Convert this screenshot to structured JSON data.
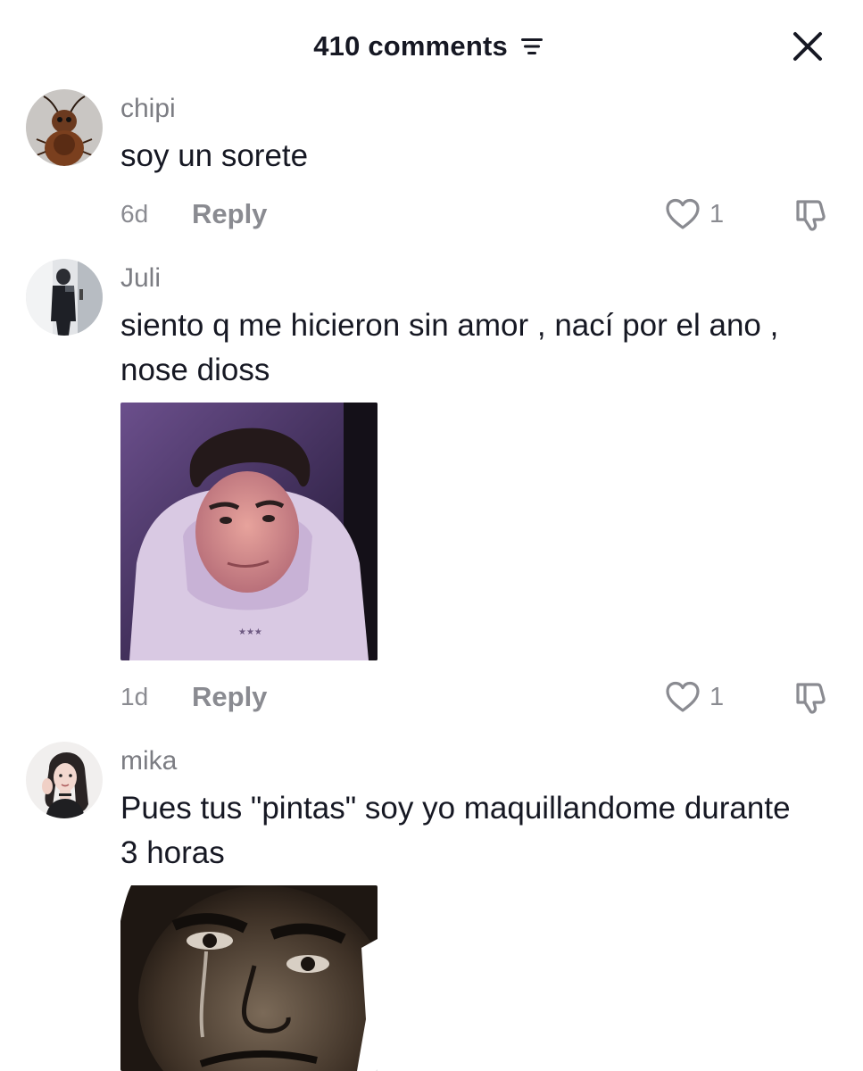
{
  "header": {
    "comment_count_label": "410 comments",
    "sort_icon": "sort-lines-icon",
    "close_icon": "close-x-icon"
  },
  "comments": [
    {
      "username": "chipi",
      "text": "soy un sorete",
      "time": "6d",
      "reply_label": "Reply",
      "likes": "1",
      "avatar": "cockroach-character-avatar"
    },
    {
      "username": "Juli",
      "text": "siento q me hicieron sin amor , nací por el ano , nose dioss",
      "time": "1d",
      "reply_label": "Reply",
      "likes": "1",
      "avatar": "mirror-selfie-avatar",
      "image": "selfie-boy-hoodie-photo"
    },
    {
      "username": "mika",
      "text": "Pues tus \"pintas\" soy yo maquillandome durante 3 horas",
      "avatar": "girl-portrait-avatar",
      "image": "crying-man-meme-photo"
    }
  ],
  "colors": {
    "text_primary": "#161823",
    "text_secondary": "#8a8b91",
    "background": "#ffffff"
  }
}
